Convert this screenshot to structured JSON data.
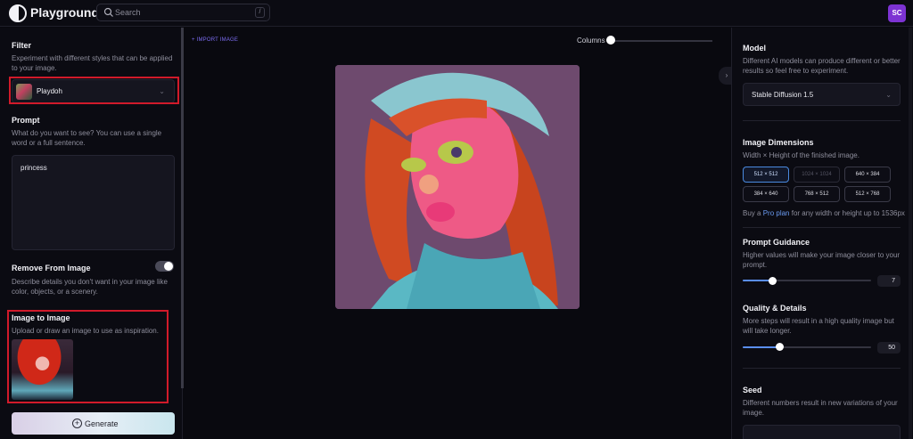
{
  "app": {
    "brand": "Playground",
    "avatar_initials": "SC"
  },
  "search": {
    "placeholder": "Search",
    "shortcut": "/"
  },
  "left": {
    "filter": {
      "title": "Filter",
      "desc": "Experiment with different styles that can be applied to your image.",
      "selected": "Playdoh"
    },
    "prompt": {
      "title": "Prompt",
      "desc": "What do you want to see? You can use a single word or a full sentence.",
      "value": "princess"
    },
    "remove": {
      "title": "Remove From Image",
      "desc": "Describe details you don't want in your image like color, objects, or a scenery.",
      "toggle_on": false
    },
    "img2img": {
      "title": "Image to Image",
      "desc": "Upload or draw an image to use as inspiration."
    },
    "generate_label": "Generate"
  },
  "center": {
    "import_label": "+ IMPORT IMAGE",
    "columns_label": "Columns",
    "columns_value": 0
  },
  "right": {
    "model": {
      "title": "Model",
      "desc": "Different AI models can produce different or better results so feel free to experiment.",
      "selected": "Stable Diffusion 1.5"
    },
    "dimensions": {
      "title": "Image Dimensions",
      "desc": "Width × Height of the finished image.",
      "options": [
        "512 × 512",
        "1024 × 1024",
        "640 × 384",
        "384 × 640",
        "768 × 512",
        "512 × 768"
      ],
      "selected": "512 × 512",
      "pro_prefix": "Buy a",
      "pro_link": "Pro plan",
      "pro_suffix": "for any width or height up to 1536px"
    },
    "guidance": {
      "title": "Prompt Guidance",
      "desc": "Higher values will make your image closer to your prompt.",
      "value": "7",
      "fraction": 0.2
    },
    "quality": {
      "title": "Quality & Details",
      "desc": "More steps will result in a high quality image but will take longer.",
      "value": "50",
      "fraction": 0.3
    },
    "seed": {
      "title": "Seed",
      "desc": "Different numbers result in new variations of your image."
    }
  },
  "colors": {
    "accent": "#5a8ef0",
    "avatar": "#7d33d3",
    "highlight_box": "#d11a2a"
  }
}
